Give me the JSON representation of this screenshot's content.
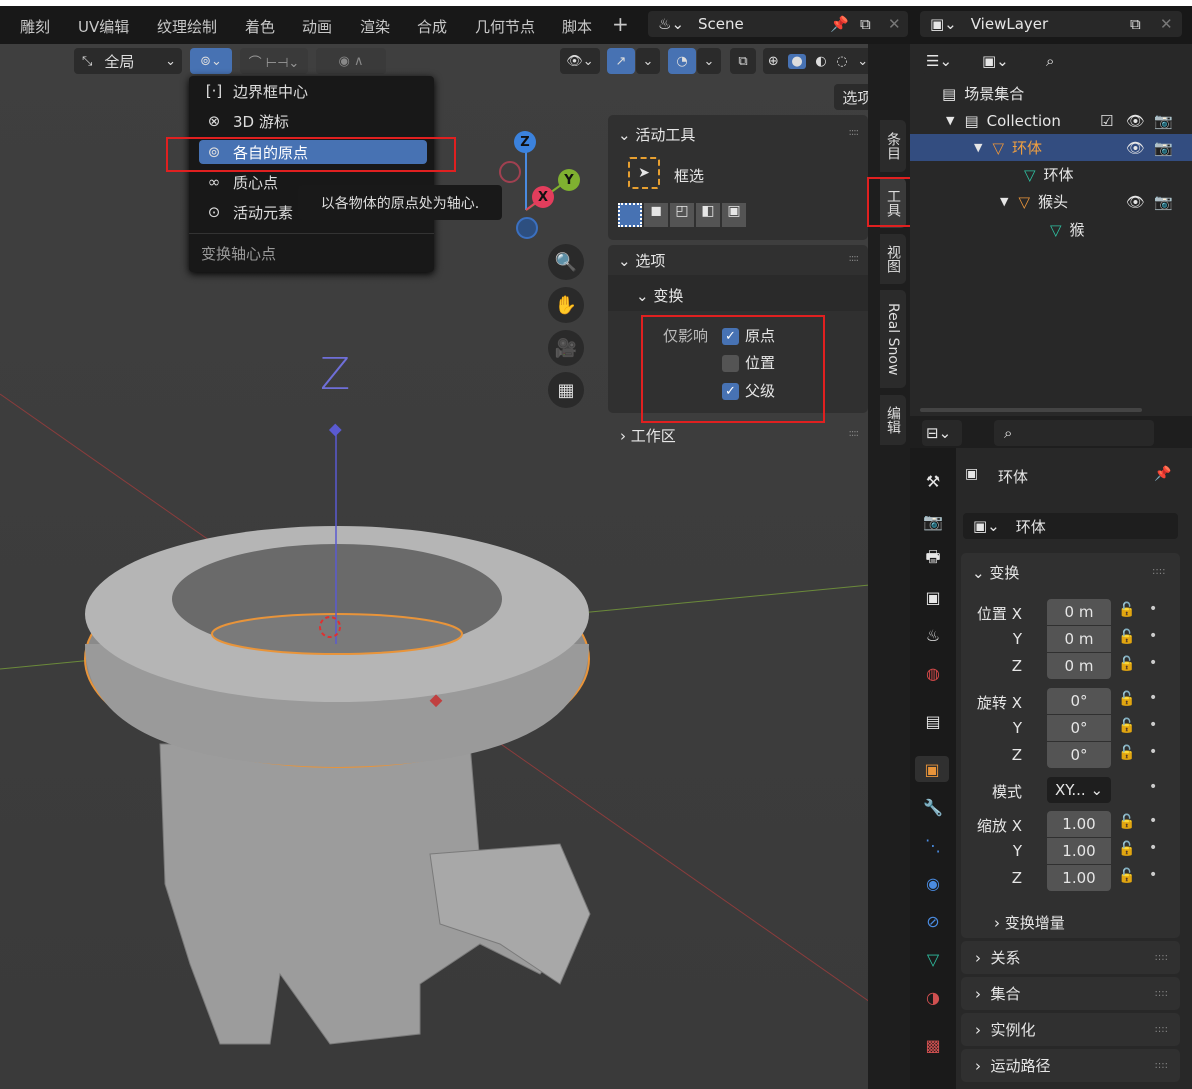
{
  "workspace_tabs": [
    "雕刻",
    "UV编辑",
    "纹理绘制",
    "着色",
    "动画",
    "渲染",
    "合成",
    "几何节点",
    "脚本"
  ],
  "add_tab": "+",
  "scene": {
    "name": "Scene"
  },
  "view_layer": {
    "name": "ViewLayer"
  },
  "viewport": {
    "orientation": "全局",
    "options_button": "选项",
    "pivot_menu": {
      "items": [
        {
          "label": "边界框中心",
          "icon": "bounding-box-center-icon"
        },
        {
          "label": "3D 游标",
          "icon": "3d-cursor-icon"
        },
        {
          "label": "各自的原点",
          "icon": "individual-origins-icon",
          "selected": true
        },
        {
          "label": "质心点",
          "icon": "median-point-icon"
        },
        {
          "label": "活动元素",
          "icon": "active-element-icon"
        }
      ],
      "footer": "变换轴心点"
    },
    "tooltip": "以各物体的原点处为轴心.",
    "gizmo": {
      "z": "Z",
      "y": "Y",
      "x": "X"
    },
    "empty_label": "Z"
  },
  "npanel": {
    "active_tool": {
      "title": "活动工具",
      "tool": "框选"
    },
    "options": {
      "title": "选项",
      "transform": "变换",
      "affect_only": "仅影响",
      "checks": [
        {
          "label": "原点",
          "checked": true
        },
        {
          "label": "位置",
          "checked": false
        },
        {
          "label": "父级",
          "checked": true
        }
      ]
    },
    "workspace": "工作区",
    "tabs": [
      "条目",
      "工具",
      "视图",
      "Real Snow",
      "编辑"
    ]
  },
  "outliner": {
    "rows": [
      {
        "label": "场景集合"
      },
      {
        "label": "Collection"
      },
      {
        "label": "环体"
      },
      {
        "label": "环体"
      },
      {
        "label": "猴头"
      },
      {
        "label": "猴"
      }
    ]
  },
  "properties": {
    "object_name": "环体",
    "name_field": "环体",
    "transform": {
      "title": "变换",
      "location_label": "位置",
      "rotation_label": "旋转",
      "scale_label": "缩放",
      "mode_label": "模式",
      "location": [
        "0 m",
        "0 m",
        "0 m"
      ],
      "rotation": [
        "0°",
        "0°",
        "0°"
      ],
      "mode": "XY...",
      "scale": [
        "1.00",
        "1.00",
        "1.00"
      ],
      "axes": [
        "X",
        "Y",
        "Z"
      ],
      "delta": "变换增量"
    },
    "panels": [
      "关系",
      "集合",
      "实例化",
      "运动路径"
    ]
  },
  "colors": {
    "accent": "#4772b3",
    "selected_row": "#334d80",
    "object_orange": "#e8943a",
    "mesh_green": "#2fbfa0",
    "highlight_red": "#e02020"
  }
}
